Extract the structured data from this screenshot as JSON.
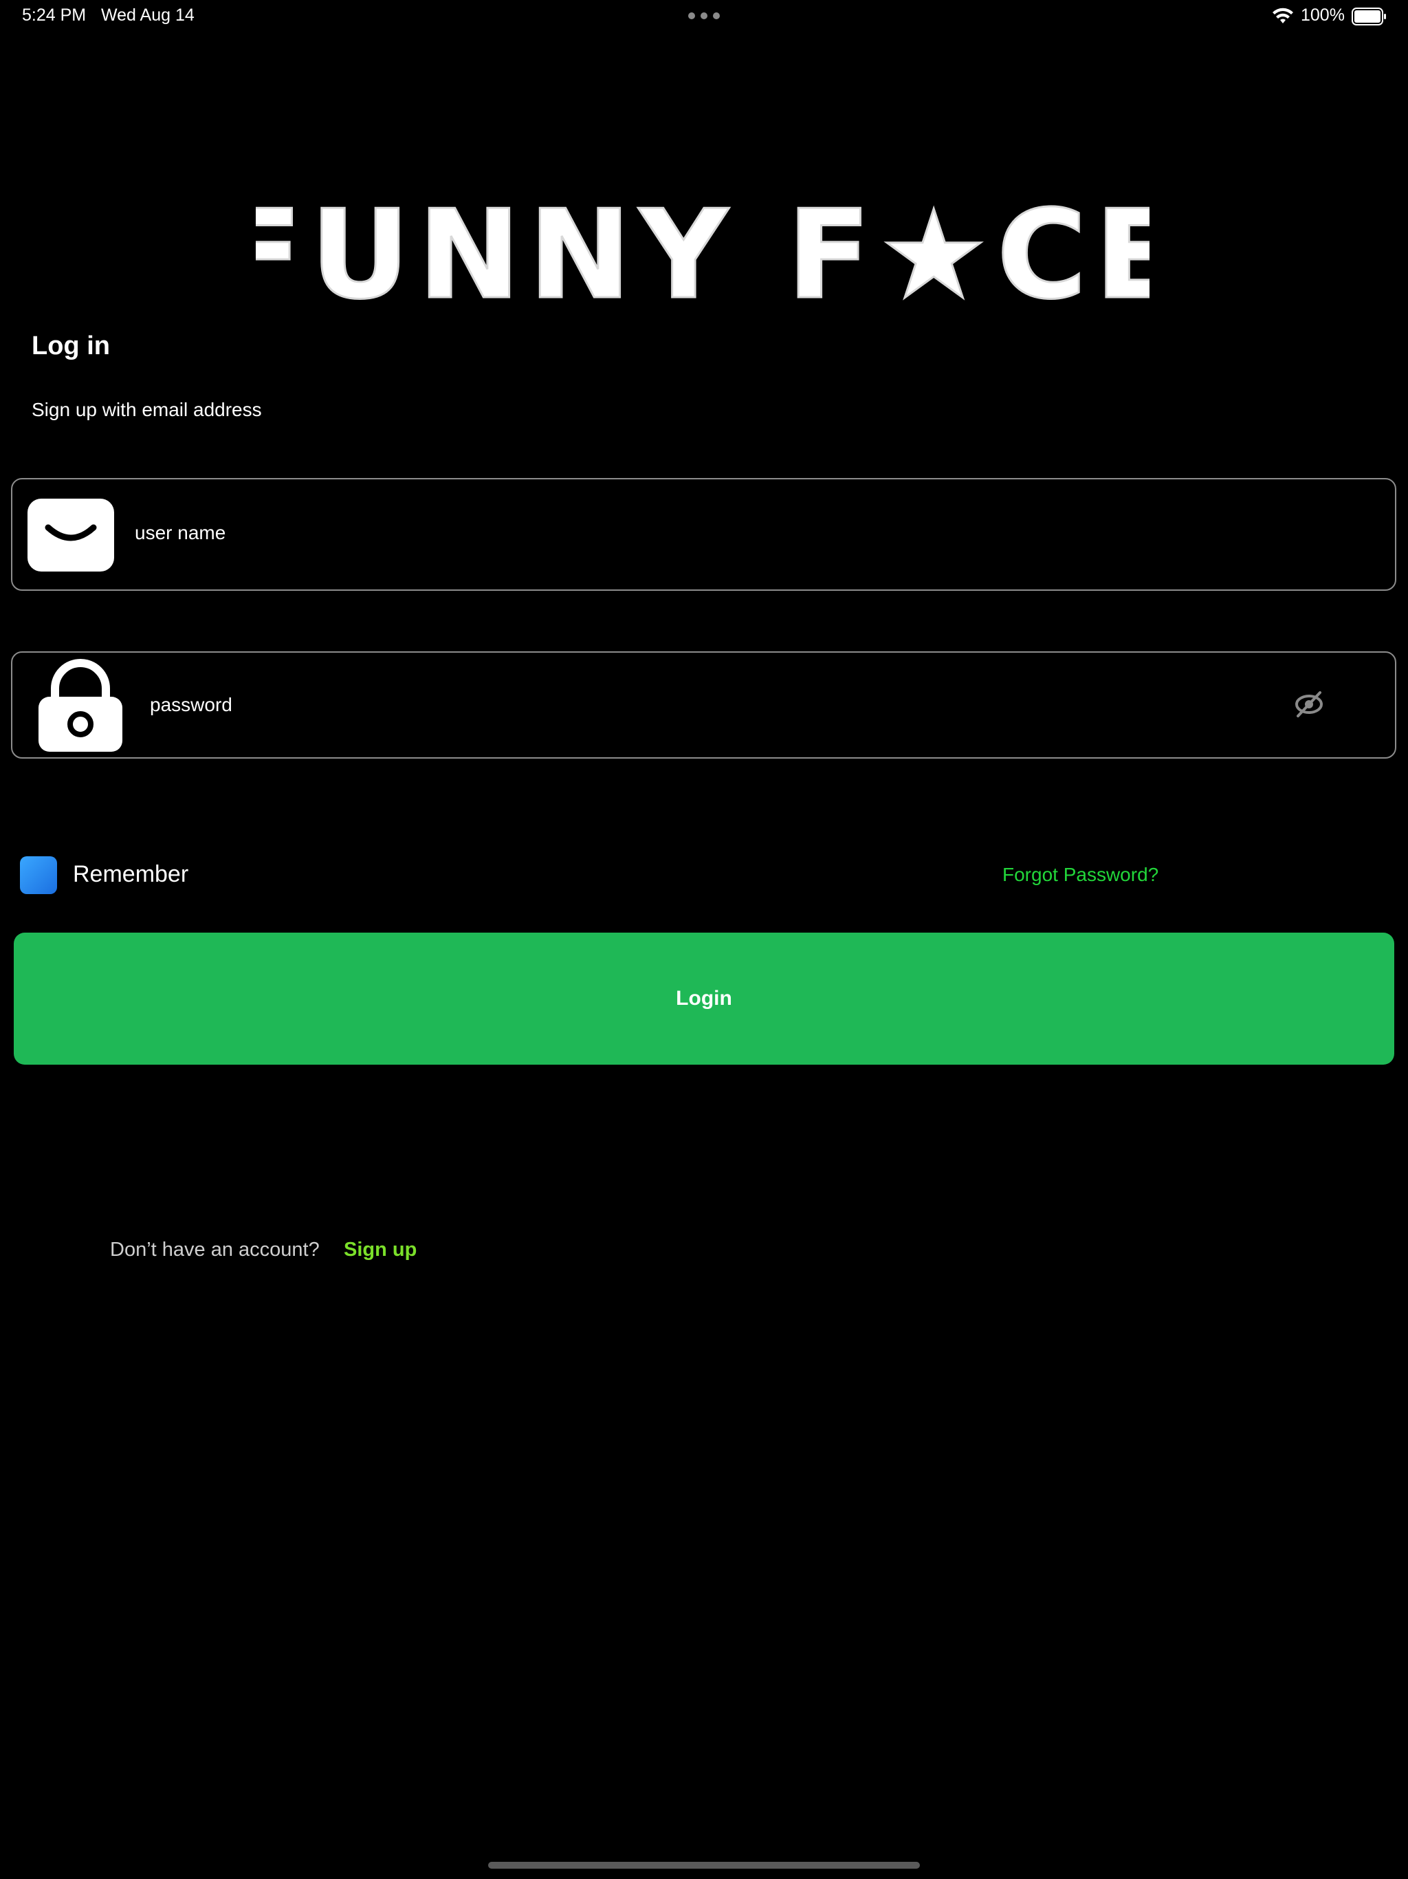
{
  "status_bar": {
    "time": "5:24 PM",
    "date": "Wed Aug 14",
    "battery": "100%",
    "icons": [
      "more-dots-icon",
      "wifi-icon",
      "battery-icon"
    ]
  },
  "logo": {
    "text": "FUNNY F★CE"
  },
  "login": {
    "title": "Log in",
    "subtitle": "Sign up with email address",
    "username_placeholder": "user name",
    "password_placeholder": "password",
    "remember_label": "Remember",
    "forgot_label": "Forgot Password?",
    "login_button": "Login",
    "signup_prompt": "Don’t have an account?",
    "signup_link": "Sign up"
  },
  "colors": {
    "background": "#000000",
    "login_button": "#1fb856",
    "forgot_link": "#22d63a",
    "signup_link": "#7be02a",
    "checkbox": "#2a8cf0"
  }
}
